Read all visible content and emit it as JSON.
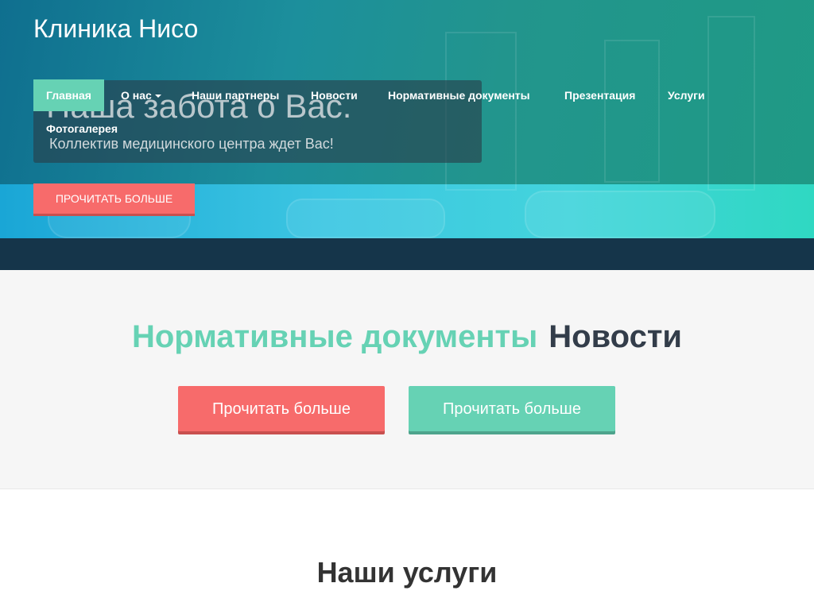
{
  "brand": "Клиника Нисо",
  "nav": {
    "items": [
      {
        "label": "Главная",
        "active": true
      },
      {
        "label": "О нас",
        "dropdown": true
      },
      {
        "label": "Наши партнеры"
      },
      {
        "label": "Новости"
      },
      {
        "label": "Нормативные документы"
      },
      {
        "label": "Презентация"
      },
      {
        "label": "Услуги"
      },
      {
        "label": "Фотогалерея"
      }
    ]
  },
  "hero": {
    "title": "Наша забота о Вас.",
    "subtitle": "Коллектив медицинского центра ждет Вас!",
    "button_label": "ПРОЧИТАТЬ БОЛЬШЕ"
  },
  "cta": {
    "headline_accent": "Нормативные документы",
    "headline_rest": "Новости",
    "button_left_label": "Прочитать больше",
    "button_right_label": "Прочитать больше"
  },
  "services": {
    "title": "Наши услуги"
  },
  "colors": {
    "accent_green": "#66d2b4",
    "accent_red": "#f76b6b",
    "dark_band": "#15354a",
    "light_bg": "#f6f6f6"
  }
}
